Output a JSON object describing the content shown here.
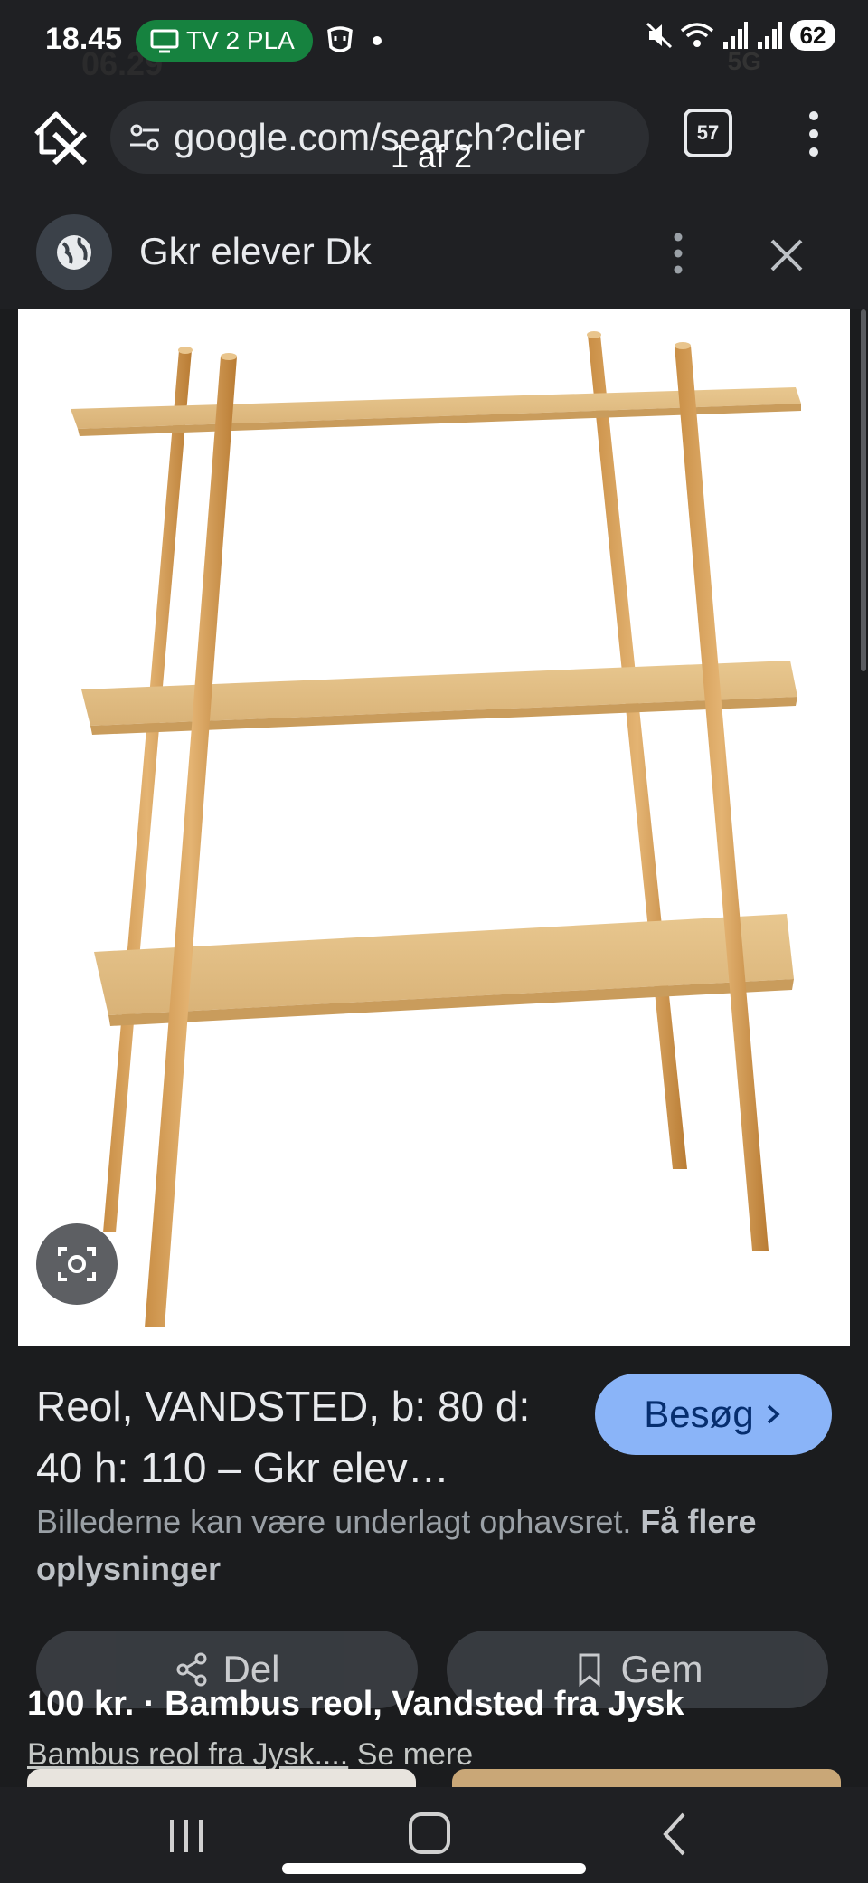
{
  "status_bar": {
    "time": "18.45",
    "cast_label": "TV 2 PLA",
    "background_time": "06.29",
    "network": "5G",
    "battery": "62"
  },
  "url_bar": {
    "url": "google.com/search?clier",
    "tab_count": "57",
    "page_counter": "1 af 2"
  },
  "source": {
    "title": "Gkr elever Dk"
  },
  "result": {
    "title": "Reol, VANDSTED, b: 80 d: 40 h: 110 – Gkr elev…",
    "visit_label": "Besøg",
    "copyright_text": "Billederne kan være underlagt ophavsret.",
    "copyright_link": "Få flere oplysninger",
    "share_label": "Del",
    "save_label": "Gem"
  },
  "related": {
    "title": "100 kr. · Bambus reol, Vandsted fra Jysk",
    "subtitle": "Bambus reol fra Jysk....",
    "more_label": "Se mere"
  },
  "colors": {
    "accent": "#8ab4f8",
    "cast_pill": "#16823f",
    "background": "#1b1c1e"
  }
}
